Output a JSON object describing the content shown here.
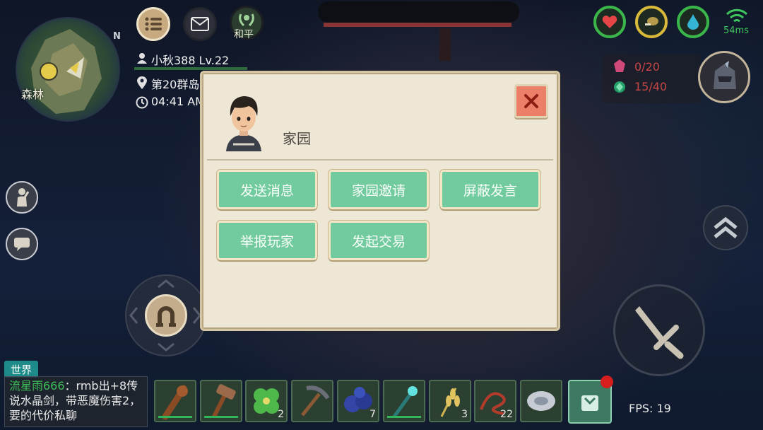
{
  "minimap": {
    "label": "森林",
    "compass": "N"
  },
  "top_buttons": {
    "peace_label": "和平"
  },
  "player": {
    "name": "小秋388 Lv.22",
    "location": "第20群岛",
    "time": "04:41 AM"
  },
  "network": {
    "ping": "54ms"
  },
  "resources": {
    "gem_red": "0/20",
    "gem_green": "15/40"
  },
  "dialog": {
    "title": "家园",
    "buttons": [
      "发送消息",
      "家园邀请",
      "屏蔽发言",
      "举报玩家",
      "发起交易"
    ]
  },
  "chat": {
    "channel": "世界",
    "sender": "流星雨666",
    "message": "：rmb出+8传说水晶剑，带恶魔伤害2，要的代价私聊"
  },
  "hotbar": {
    "counts": [
      "",
      "",
      "2",
      "",
      "7",
      "",
      "3",
      "22",
      ""
    ]
  },
  "fps": "FPS: 19",
  "colors": {
    "accent_green": "#71cb9e",
    "close_red": "#ec7f68",
    "status_green": "#3bb64a"
  }
}
